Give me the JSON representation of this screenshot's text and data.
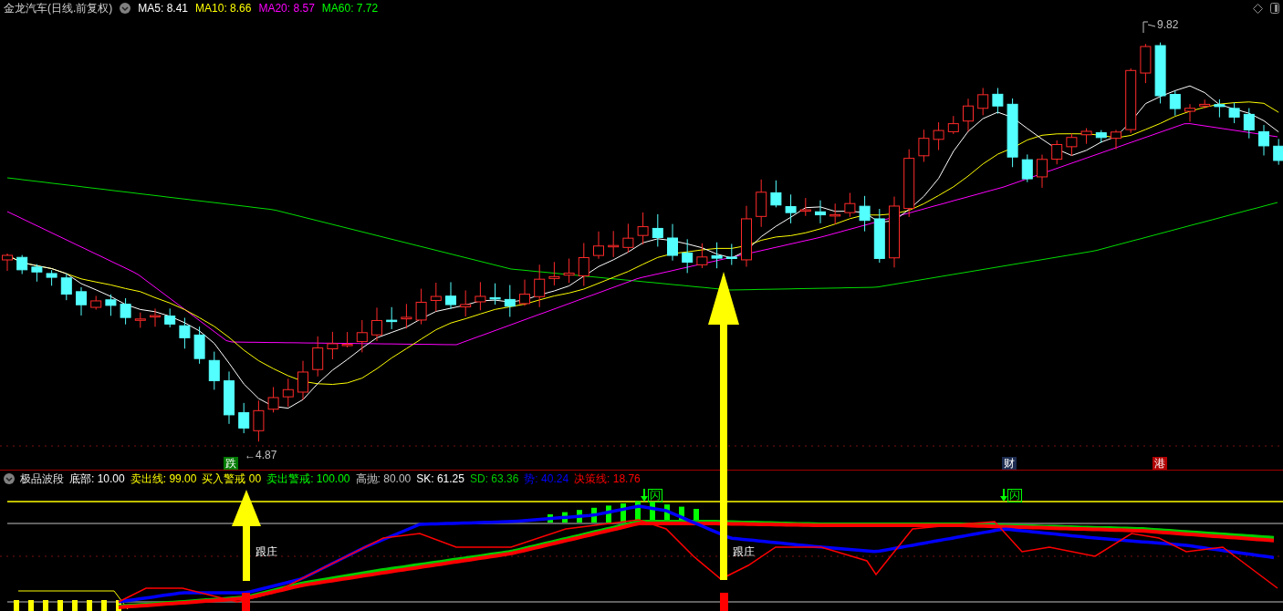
{
  "chart": {
    "title": "金龙汽车(日线.前复权)",
    "ma": [
      {
        "label": "MA5:",
        "value": "8.41",
        "color": "#ffffff"
      },
      {
        "label": "MA10:",
        "value": "8.66",
        "color": "#ffff00"
      },
      {
        "label": "MA20:",
        "value": "8.57",
        "color": "#ff00ff"
      },
      {
        "label": "MA60:",
        "value": "7.72",
        "color": "#00ff00"
      }
    ],
    "high_label": "9.82",
    "low_label": "←4.87",
    "markers": [
      {
        "text": "跌",
        "color": "#007a00"
      },
      {
        "text": "财",
        "color": "#1c2b4f"
      },
      {
        "text": "港",
        "color": "#b00000"
      }
    ]
  },
  "indicator": {
    "name": "极品波段",
    "items": [
      {
        "label": "底部:",
        "value": "10.00",
        "color": "#ffffff"
      },
      {
        "label": "卖出线:",
        "value": "99.00",
        "color": "#ffff00"
      },
      {
        "label": "买入警戒",
        "value": "00",
        "color": "#ffff00"
      },
      {
        "label": "卖出警戒:",
        "value": "100.00",
        "color": "#00ff00"
      },
      {
        "label": "高抛:",
        "value": "80.00",
        "color": "#c0c0c0"
      },
      {
        "label": "SK:",
        "value": "61.25",
        "color": "#ffffff"
      },
      {
        "label": "SD:",
        "value": "63.36",
        "color": "#00cc00"
      },
      {
        "label": "势:",
        "value": "40.24",
        "color": "#0000ff"
      },
      {
        "label": "决策线:",
        "value": "18.76",
        "color": "#ff0000"
      }
    ],
    "signals": [
      "闪",
      "闪"
    ],
    "tags": [
      "跟庄",
      "跟庄"
    ]
  }
}
